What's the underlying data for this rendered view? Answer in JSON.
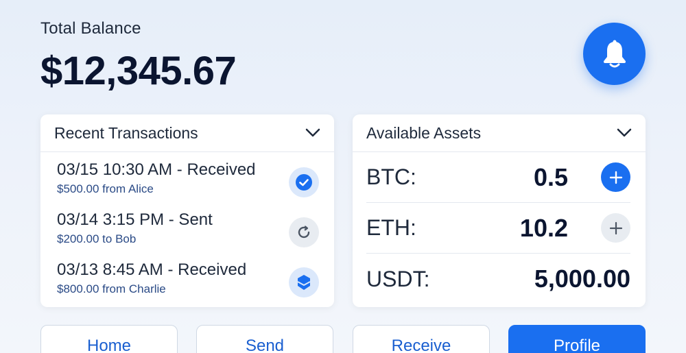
{
  "header": {
    "balance_label": "Total Balance",
    "balance_amount": "$12,345.67",
    "notification_icon": "bell-icon"
  },
  "transactions": {
    "title": "Recent Transactions",
    "items": [
      {
        "title": "03/15 10:30 AM - Received",
        "detail": "$500.00 from Alice",
        "status_icon": "check-circle-icon",
        "status": "completed"
      },
      {
        "title": "03/14 3:15 PM - Sent",
        "detail": "$200.00 to Bob",
        "status_icon": "pending-refresh-icon",
        "status": "pending"
      },
      {
        "title": "03/13 8:45 AM - Received",
        "detail": "$800.00 from Charlie",
        "status_icon": "shield-icon",
        "status": "secured"
      }
    ]
  },
  "assets": {
    "title": "Available Assets",
    "items": [
      {
        "label": "BTC:",
        "value": "0.5",
        "action_icon": "plus-icon",
        "action_style": "primary"
      },
      {
        "label": "ETH:",
        "value": "10.2",
        "action_icon": "plus-icon",
        "action_style": "muted"
      },
      {
        "label": "USDT:",
        "value": "5,000.00"
      }
    ]
  },
  "nav": {
    "home": "Home",
    "send": "Send",
    "receive": "Receive",
    "profile": "Profile",
    "active": "profile"
  },
  "colors": {
    "accent": "#1a6ff0",
    "text_dark": "#0b1530",
    "sub_text": "#2a4a86",
    "muted_bg": "#e8ecf1"
  }
}
